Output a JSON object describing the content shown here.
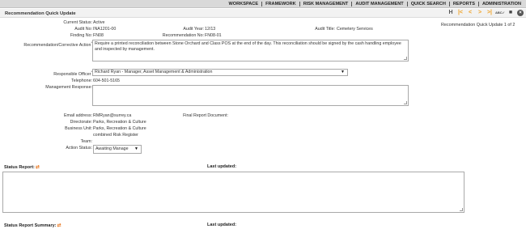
{
  "topnav": {
    "items": [
      "WORKSPACE",
      "FRAMEWORK",
      "RISK MANAGEMENT",
      "AUDIT MANAGEMENT",
      "QUICK SEARCH",
      "REPORTS",
      "ADMINISTRATION"
    ]
  },
  "titlebar": {
    "title": "Recommendation Quick Update",
    "toolbar": {
      "history_glyph": "H",
      "first_glyph": "|<",
      "prev_glyph": "<",
      "next_glyph": ">",
      "last_glyph": ">|",
      "spell_glyph": "ABC✓",
      "save_glyph": "■",
      "close_glyph": "×"
    }
  },
  "record_counter": "Recommendation Quick Update 1 of 2",
  "fields": {
    "current_status": {
      "label": "Current Status:",
      "value": "Active"
    },
    "audit_no": {
      "label": "Audit No:",
      "value": "INA1201-00"
    },
    "audit_year": {
      "label": "Audit Year:",
      "value": "12/13"
    },
    "audit_title": {
      "label": "Audit Title:",
      "value": "Cemetery Services"
    },
    "finding_no": {
      "label": "Finding No:",
      "value": "FN08"
    },
    "recommendation_no": {
      "label": "Recommendation No:",
      "value": "FN08-01"
    },
    "recommendation": {
      "label": "Recommendation/Corrective Action",
      "value": "Require a printed reconciliation between Stone Orchard and Class POS at the end of the day. This reconciliation should be signed by the cash handling employee and inspected by management."
    },
    "responsible_officer": {
      "label": "Responsible Officer",
      "value": "Richard Ryan - Manager, Asset Management & Administration"
    },
    "telephone": {
      "label": "Telephone:",
      "value": "604-501-5165"
    },
    "management_response": {
      "label": "Management Response:",
      "value": ""
    },
    "email": {
      "label": "Email address:",
      "value": "RMRyan@surrey.ca"
    },
    "final_report": {
      "label": "Final Report Document:",
      "value": ""
    },
    "directorate": {
      "label": "Directorate:",
      "value": "Parks, Recreation & Culture"
    },
    "business_unit": {
      "label": "Business Unit:",
      "value": "Parks, Recreation & Culture combined Risk Register"
    },
    "team": {
      "label": "Team:",
      "value": ""
    },
    "action_status": {
      "label": "Action Status:",
      "value": "Awaiting Manage"
    }
  },
  "status_report": {
    "label": "Status Report:",
    "last_updated_label": "Last updated:",
    "value": ""
  },
  "status_report_summary": {
    "label": "Status Report Summary:",
    "last_updated_label": "Last updated:"
  },
  "required_marker": "*",
  "colors": {
    "nav_arrow": "#f0a020",
    "refresh_icon": "#e8741a",
    "nav_bg": "#d9d9d9"
  }
}
